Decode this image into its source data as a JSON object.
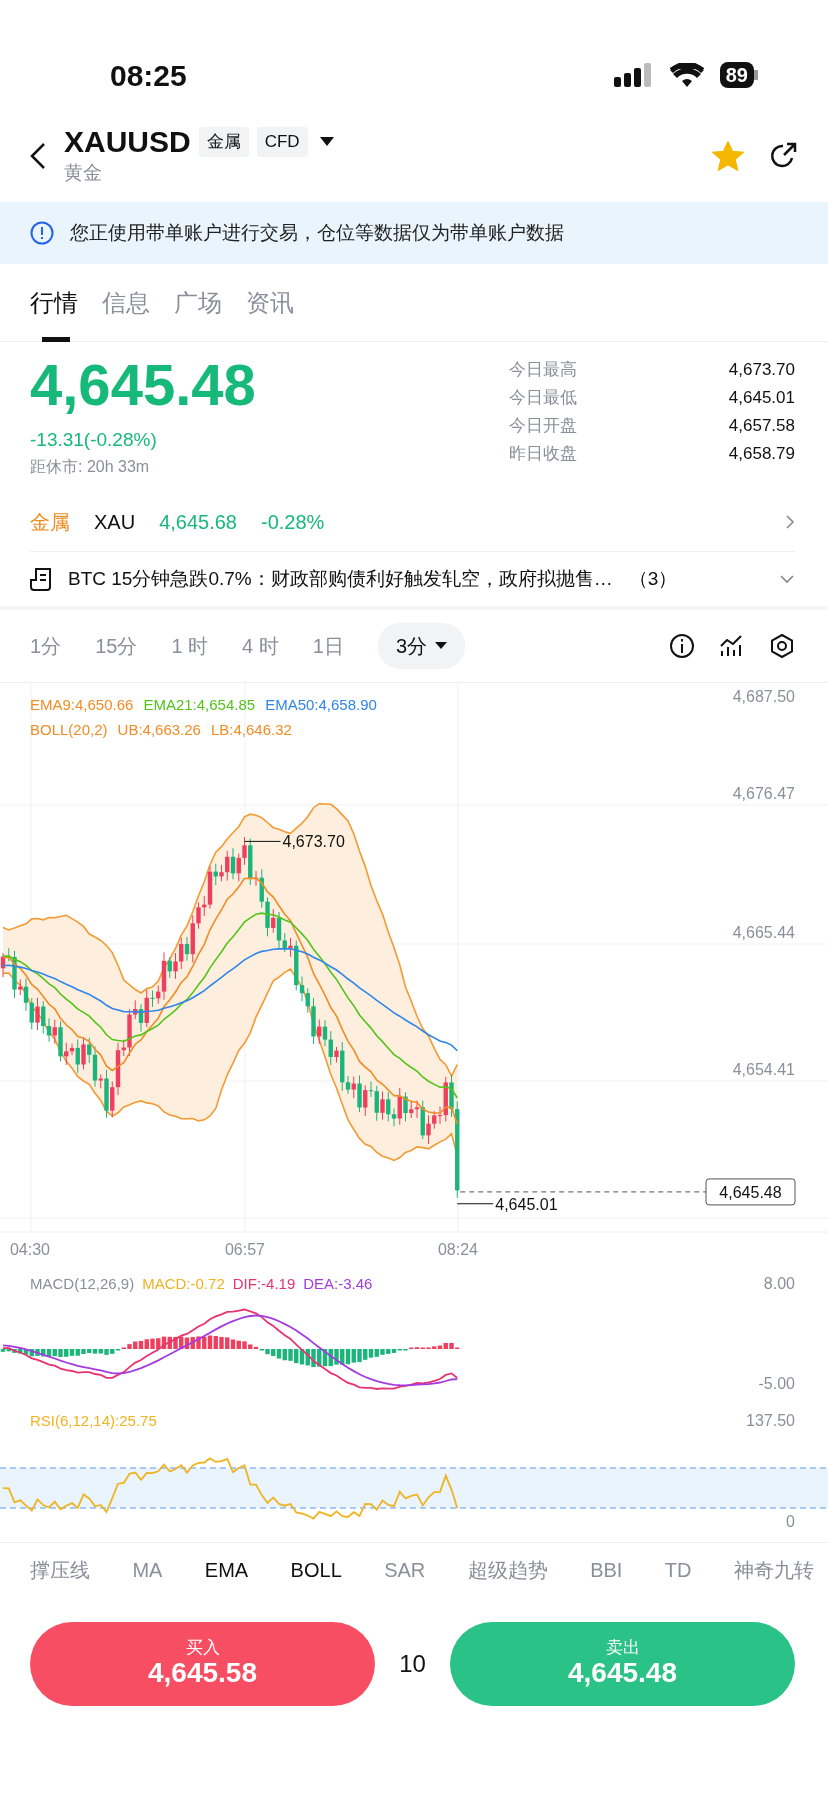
{
  "status_bar": {
    "time": "08:25",
    "battery": "89"
  },
  "header": {
    "symbol": "XAUUSD",
    "tags": [
      "金属",
      "CFD"
    ],
    "subtitle": "黄金",
    "favorite": true
  },
  "notice": "您正使用带单账户进行交易，仓位等数据仅为带单账户数据",
  "tabs": [
    {
      "label": "行情",
      "selected": true
    },
    {
      "label": "信息",
      "selected": false
    },
    {
      "label": "广场",
      "selected": false
    },
    {
      "label": "资讯",
      "selected": false
    }
  ],
  "quote": {
    "price": "4,645.48",
    "change": "-13.31(-0.28%)",
    "countdown": "距休市: 20h 33m",
    "stats": [
      {
        "label": "今日最高",
        "value": "4,673.70"
      },
      {
        "label": "今日最低",
        "value": "4,645.01"
      },
      {
        "label": "今日开盘",
        "value": "4,657.58"
      },
      {
        "label": "昨日收盘",
        "value": "4,658.79"
      }
    ]
  },
  "related": {
    "category": "金属",
    "symbol": "XAU",
    "price": "4,645.68",
    "change": "-0.28%"
  },
  "news": {
    "text": "BTC 15分钟急跌0.7%：财政部购债利好触发轧空，政府拟抛售…",
    "count": "（3）"
  },
  "timeframes": [
    {
      "label": "1分",
      "selected": false
    },
    {
      "label": "15分",
      "selected": false
    },
    {
      "label": "1 时",
      "selected": false
    },
    {
      "label": "4 时",
      "selected": false
    },
    {
      "label": "1日",
      "selected": false
    },
    {
      "label": "3分",
      "selected": true
    }
  ],
  "chart": {
    "legend": [
      {
        "text": "EMA9:4,650.66",
        "color": "#f08c24"
      },
      {
        "text": "EMA21:4,654.85",
        "color": "#52c41a"
      },
      {
        "text": "EMA50:4,658.90",
        "color": "#2f86e8"
      }
    ],
    "boll_legend": [
      "BOLL(20,2)",
      "UB:4,663.26",
      "LB:4,646.32"
    ],
    "y_labels": [
      "4,687.50",
      "4,676.47",
      "4,665.44",
      "4,654.41"
    ],
    "x_labels": [
      "04:30",
      "06:57",
      "08:24"
    ],
    "high_label": "4,673.70",
    "low_label": "4,645.01",
    "last_price": "4,645.48"
  },
  "macd": {
    "legend": [
      {
        "text": "MACD(12,26,9)",
        "color": "#8a8f99"
      },
      {
        "text": "MACD:-0.72",
        "color": "#f0b321"
      },
      {
        "text": "DIF:-4.19",
        "color": "#e8336f"
      },
      {
        "text": "DEA:-3.46",
        "color": "#a23be0"
      }
    ],
    "y_labels": [
      "8.00",
      "-5.00"
    ]
  },
  "rsi": {
    "title": "RSI(6,12,14):25.75",
    "y_labels": [
      "137.50",
      "0"
    ]
  },
  "indicators": [
    {
      "label": "撑压线",
      "selected": false
    },
    {
      "label": "MA",
      "selected": false
    },
    {
      "label": "EMA",
      "selected": true
    },
    {
      "label": "BOLL",
      "selected": true
    },
    {
      "label": "SAR",
      "selected": false
    },
    {
      "label": "超级趋势",
      "selected": false
    },
    {
      "label": "BBI",
      "selected": false
    },
    {
      "label": "TD",
      "selected": false
    },
    {
      "label": "神奇九转",
      "selected": false
    }
  ],
  "trade": {
    "buy": {
      "label": "买入",
      "price": "4,645.58"
    },
    "quantity": "10",
    "sell": {
      "label": "卖出",
      "price": "4,645.48"
    }
  }
}
